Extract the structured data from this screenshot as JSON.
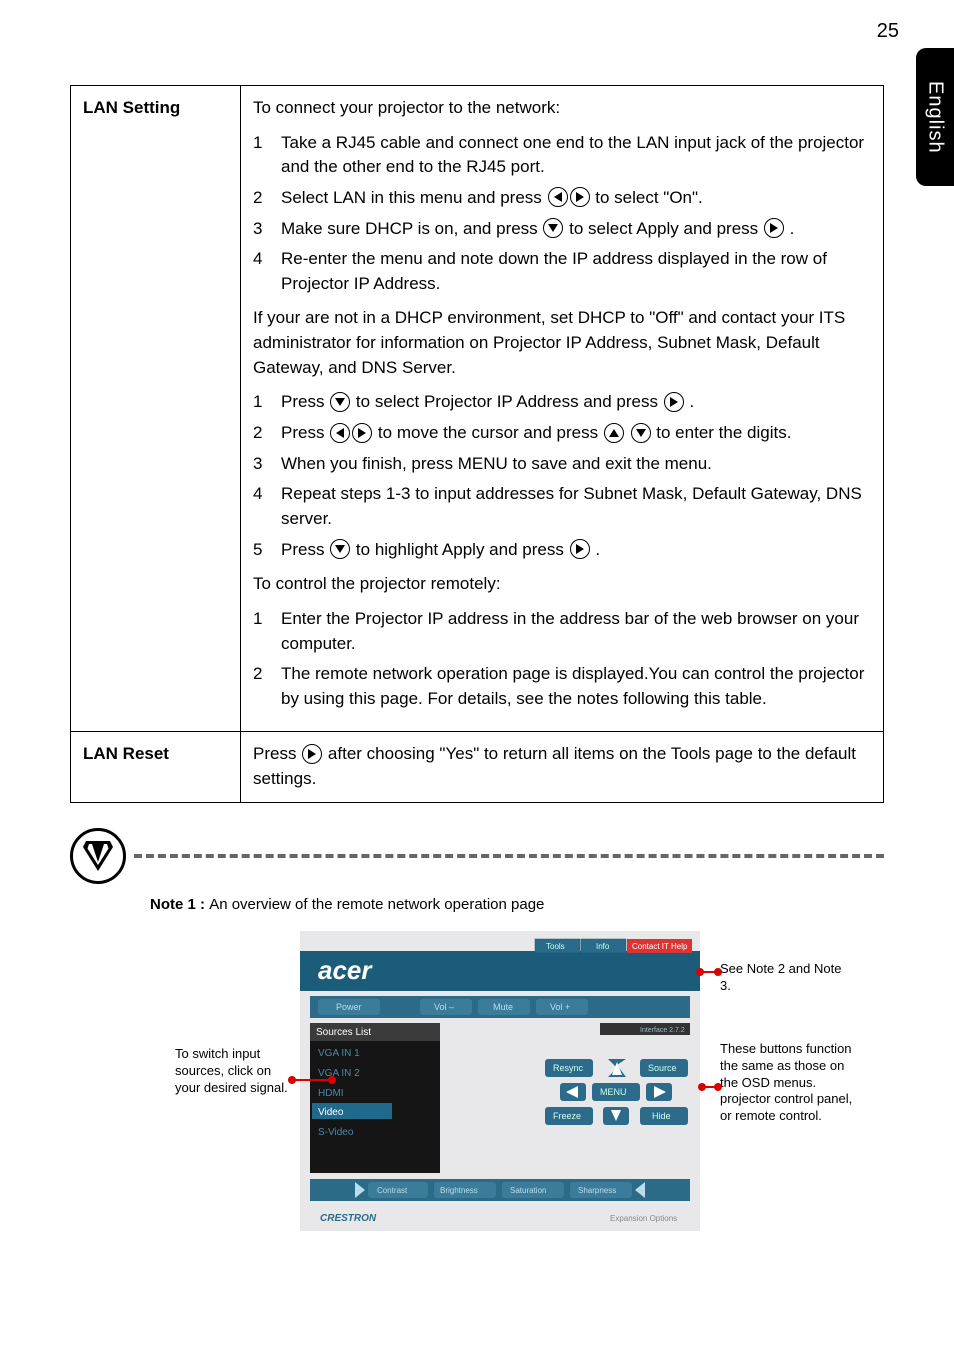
{
  "page_num": "25",
  "side_tab": "English",
  "table": {
    "row1": {
      "label": "LAN Setting",
      "intro": "To connect your projector to the network:",
      "steps_a": {
        "1": "Take a RJ45 cable and connect one end to the LAN input jack of the projector and the other end to the RJ45 port.",
        "2_a": "Select LAN in this menu and press ",
        "2_b": " to select \"On\".",
        "3_a": "Make sure DHCP is on, and press ",
        "3_b": " to select Apply and press ",
        "3_c": " .",
        "4": "Re-enter the menu and note down the IP address displayed in the row of Projector IP Address."
      },
      "para_mid": "If your are not in a DHCP environment, set DHCP to \"Off\" and contact your ITS administrator for information on Projector IP Address, Subnet Mask, Default Gateway, and DNS Server.",
      "steps_b": {
        "1_a": "Press ",
        "1_b": " to select Projector IP Address and press ",
        "1_c": " .",
        "2_a": "Press ",
        "2_b": " to move the cursor and press ",
        "2_c": " to enter the digits.",
        "3": "When you finish, press MENU to save and exit the menu.",
        "4": "Repeat steps 1-3 to input addresses for Subnet Mask, Default Gateway, DNS server.",
        "5_a": "Press ",
        "5_b": " to highlight Apply and press ",
        "5_c": " ."
      },
      "intro2": "To control the projector remotely:",
      "steps_c": {
        "1": "Enter the Projector IP address in the address bar of the web browser on your computer.",
        "2": "The remote network operation page is displayed.You can control the projector by using this page. For details, see the notes following this table."
      }
    },
    "row2": {
      "label": "LAN Reset",
      "text_a": "Press ",
      "text_b": " after choosing \"Yes\" to return all items on the Tools page to the default settings."
    }
  },
  "note1_label": "Note 1 : ",
  "note1_text": "An overview of the remote network operation page",
  "overview": {
    "left_callout": "To switch input sources, click on your desired signal.",
    "right_top_callout": "See Note 2 and Note 3.",
    "right_bot_callout": "These buttons function the same as those on the OSD menus. projector control panel, or remote control.",
    "screenshot": {
      "brand": "acer",
      "tabs": [
        "Tools",
        "Info",
        "Contact IT Help"
      ],
      "top_buttons": [
        "Power",
        "Vol –",
        "Mute",
        "Vol +"
      ],
      "list_header": "Sources List",
      "sources": [
        "VGA IN 1",
        "VGA IN 2",
        "HDMI",
        "Video",
        "S-Video"
      ],
      "right_buttons": [
        "Resync",
        "Source",
        "MENU",
        "Freeze",
        "Hide"
      ],
      "bottom_buttons": [
        "Contrast",
        "Brightness",
        "Saturation",
        "Sharpness"
      ],
      "footer_logo": "CRESTRON",
      "footer_text": "Expansion Options",
      "interface_label": "Interface 2.7.2"
    }
  }
}
